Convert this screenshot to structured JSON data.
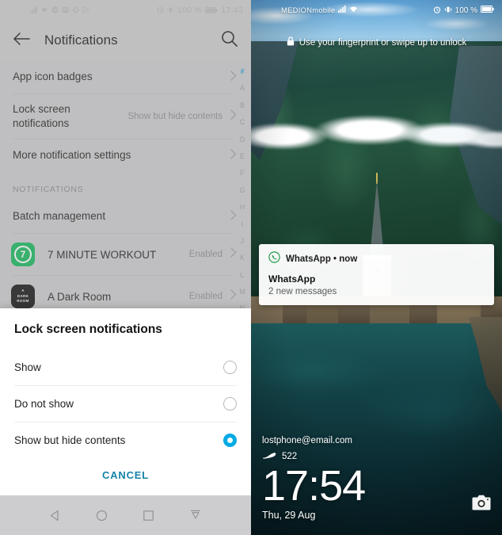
{
  "settings": {
    "statusbar": {
      "left_icons": [
        "signal-icon",
        "wifi-icon",
        "message-icon",
        "app-icon",
        "settings-icon",
        "play-icon"
      ],
      "alarm_icon": "alarm-icon",
      "vibrate_icon": "vibrate-icon",
      "battery_text": "100 %",
      "battery_icon": "battery-icon",
      "time": "17:43"
    },
    "appbar": {
      "back_icon": "back-arrow-icon",
      "title": "Notifications",
      "search_icon": "search-icon"
    },
    "top_rows": [
      {
        "label": "App icon badges",
        "value": ""
      },
      {
        "label": "Lock screen notifications",
        "value": "Show but hide contents"
      },
      {
        "label": "More notification settings",
        "value": ""
      }
    ],
    "section_header": "NOTIFICATIONS",
    "batch_row": {
      "label": "Batch management",
      "value": ""
    },
    "apps": [
      {
        "name": "7 MINUTE WORKOUT",
        "value": "Enabled",
        "icon": "seven-minute-workout-icon",
        "icon_text": "7"
      },
      {
        "name": "A Dark Room",
        "value": "Enabled",
        "icon": "a-dark-room-icon",
        "icon_l1": "A",
        "icon_l2": "DARK",
        "icon_l3": "ROOM"
      }
    ],
    "index": [
      "#",
      "A",
      "B",
      "C",
      "D",
      "E",
      "F",
      "G",
      "H",
      "I",
      "J",
      "K",
      "L",
      "M",
      "N"
    ],
    "index_active": "#",
    "dialog": {
      "title": "Lock screen notifications",
      "options": [
        {
          "label": "Show",
          "selected": false
        },
        {
          "label": "Do not show",
          "selected": false
        },
        {
          "label": "Show but hide contents",
          "selected": true
        }
      ],
      "cancel_label": "CANCEL"
    },
    "navbar": {
      "back_icon": "nav-back-triangle-icon",
      "home_icon": "nav-home-circle-icon",
      "recents_icon": "nav-recents-square-icon",
      "dropdown_icon": "nav-notification-shade-icon"
    }
  },
  "lockscreen": {
    "statusbar": {
      "carrier": "MEDIONmobile",
      "signal_icon": "signal-icon",
      "wifi_icon": "wifi-icon",
      "alarm_icon": "alarm-icon",
      "vibrate_icon": "vibrate-icon",
      "battery_text": "100 %",
      "battery_icon": "battery-icon"
    },
    "unlock_hint": {
      "lock_icon": "lock-icon",
      "text": "Use your fingerprint or swipe up to unlock"
    },
    "notification": {
      "app_icon": "whatsapp-icon",
      "header": "WhatsApp • now",
      "title": "WhatsApp",
      "body": "2 new messages"
    },
    "info": {
      "email": "lostphone@email.com",
      "steps_icon": "shoe-icon",
      "steps": "522",
      "time": "17:54",
      "date": "Thu, 29 Aug"
    },
    "camera_icon": "camera-icon"
  },
  "colors": {
    "accent_blue": "#00aae4",
    "cancel_teal": "#1784a8",
    "index_active": "#1f9ed0",
    "workout_green": "#12b65a",
    "whatsapp_green": "#259d4e"
  }
}
